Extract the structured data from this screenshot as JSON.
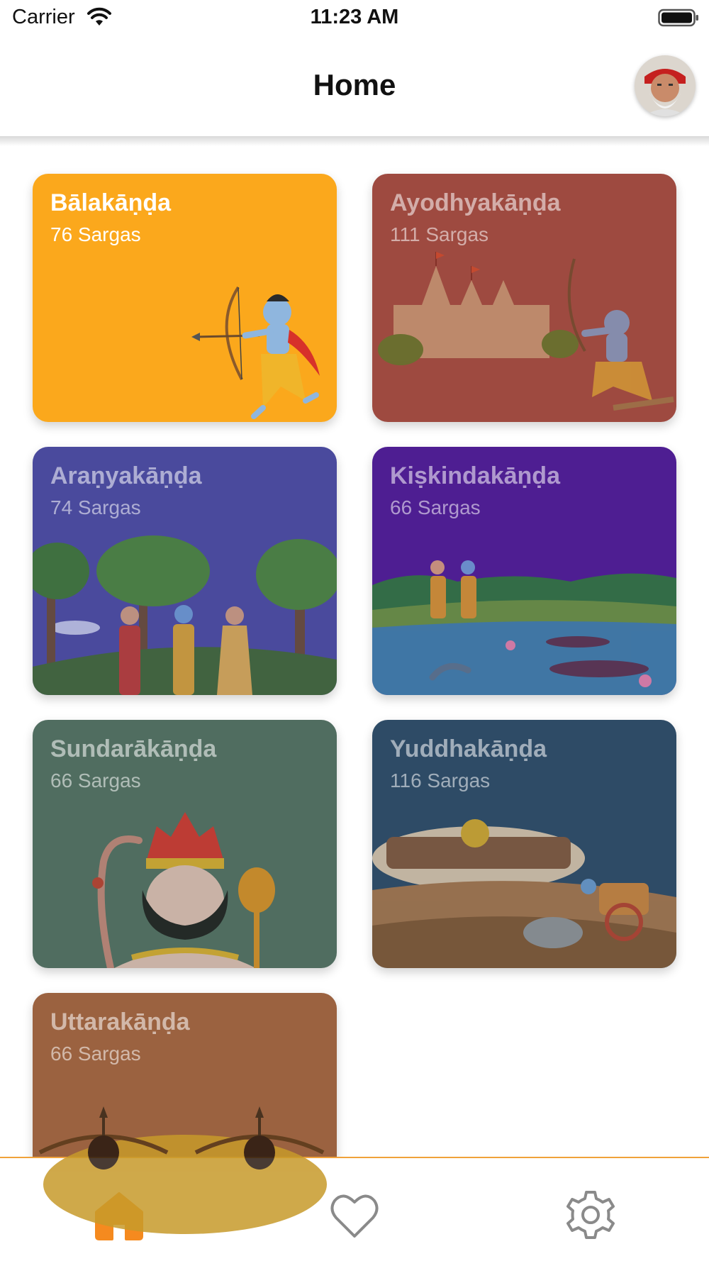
{
  "status_bar": {
    "carrier": "Carrier",
    "time": "11:23 AM",
    "wifi_icon": "wifi-icon",
    "battery_icon": "battery-icon"
  },
  "header": {
    "title": "Home",
    "avatar_icon": "profile-avatar"
  },
  "kandas": [
    {
      "title": "Bālakāṇḍa",
      "subtitle": "76 Sargas",
      "color": "#fba81c",
      "art": "rama-archer-child"
    },
    {
      "title": "Ayodhyakāṇḍa",
      "subtitle": "111 Sargas",
      "color": "#9e4a40",
      "art": "temple-and-archer"
    },
    {
      "title": "Araṇyakāṇḍa",
      "subtitle": "74 Sargas",
      "color": "#4a4a9d",
      "art": "forest-trio"
    },
    {
      "title": "Kiṣkindakāṇḍa",
      "subtitle": "66 Sargas",
      "color": "#4e1e92",
      "art": "river-lake"
    },
    {
      "title": "Sundarākāṇḍa",
      "subtitle": "66 Sargas",
      "color": "#506d60",
      "art": "hanuman"
    },
    {
      "title": "Yuddhakāṇḍa",
      "subtitle": "116 Sargas",
      "color": "#2e4b66",
      "art": "ravana-chariot"
    },
    {
      "title": "Uttarakāṇḍa",
      "subtitle": "66 Sargas",
      "color": "#9b6240",
      "art": "bows-and-arrows"
    }
  ],
  "bottom_nav": {
    "items": [
      {
        "name": "home",
        "icon": "home-icon",
        "active": true,
        "color": "#f58a1f"
      },
      {
        "name": "favorites",
        "icon": "heart-icon",
        "active": false,
        "color": "#8a8a8a"
      },
      {
        "name": "settings",
        "icon": "gear-icon",
        "active": false,
        "color": "#8a8a8a"
      }
    ]
  }
}
